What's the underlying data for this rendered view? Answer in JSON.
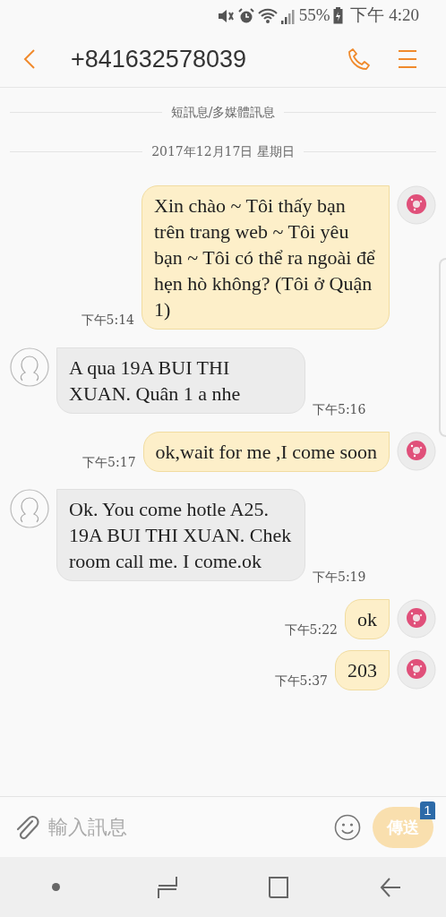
{
  "status_bar": {
    "battery": "55%",
    "time": "下午 4:20"
  },
  "header": {
    "title": "+841632578039"
  },
  "dividers": [
    {
      "text": "短訊息/多媒體訊息"
    },
    {
      "text": "2017年12月17日 星期日"
    }
  ],
  "messages": [
    {
      "kind": "sent",
      "text": "Xin chào ~ Tôi thấy bạn trên trang web ~ Tôi yêu bạn ~ Tôi có thể ra ngoài để hẹn hò không? (Tôi ở Quận 1)",
      "time": "下午5:14"
    },
    {
      "kind": "received",
      "text": "A qua 19A BUI THI XUAN. Quân 1 a nhe",
      "time": "下午5:16"
    },
    {
      "kind": "sent",
      "text": "ok,wait for me ,I come soon",
      "time": "下午5:17"
    },
    {
      "kind": "received",
      "text": "Ok. You come hotle A25. 19A BUI THI XUAN. Chek room call me. I come.ok",
      "time": "下午5:19"
    },
    {
      "kind": "sent",
      "text": "ok",
      "time": "下午5:22"
    },
    {
      "kind": "sent",
      "text": "203",
      "time": "下午5:37"
    }
  ],
  "composer": {
    "placeholder": "輸入訊息",
    "send": "傳送",
    "badge": "1"
  }
}
